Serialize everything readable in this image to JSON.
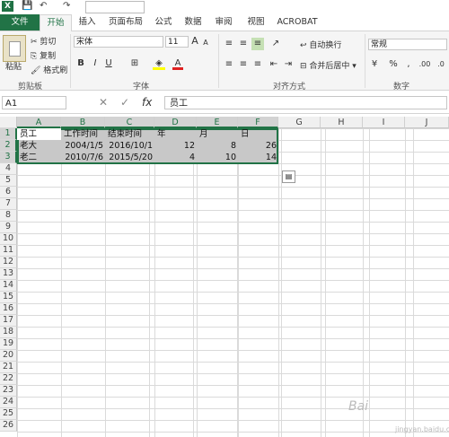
{
  "qat": {
    "logo": "X",
    "save": "💾",
    "undo": "↶",
    "redo": "↷"
  },
  "tabs": [
    "文件",
    "开始",
    "插入",
    "页面布局",
    "公式",
    "数据",
    "审阅",
    "视图",
    "ACROBAT"
  ],
  "clipboard": {
    "paste": "粘贴",
    "cut": "剪切",
    "copy": "复制",
    "format_painter": "格式刷",
    "group": "剪贴板"
  },
  "font": {
    "name": "宋体",
    "size": "11",
    "group": "字体",
    "grow": "A",
    "shrink": "A",
    "bold": "B",
    "italic": "I",
    "underline": "U",
    "fontcolor": "A"
  },
  "align": {
    "wrap": "自动换行",
    "merge": "合并后居中",
    "group": "对齐方式"
  },
  "number": {
    "format": "常规",
    "group": "数字",
    "percent": "%",
    "comma": ","
  },
  "formula_bar": {
    "name_box": "A1",
    "fx": "fx",
    "cancel": "✕",
    "confirm": "✓",
    "value": "员工"
  },
  "columns": [
    "A",
    "B",
    "C",
    "D",
    "E",
    "F",
    "G",
    "H",
    "I",
    "J"
  ],
  "rows": [
    "1",
    "2",
    "3",
    "4",
    "5",
    "6",
    "7",
    "8",
    "9",
    "10",
    "11",
    "12",
    "13",
    "14",
    "15",
    "16",
    "17",
    "18",
    "19",
    "20",
    "21",
    "22",
    "23",
    "24",
    "25",
    "26"
  ],
  "cells": {
    "A1": "员工",
    "B1": "工作时间",
    "C1": "结束时间",
    "D1": "年",
    "E1": "月",
    "F1": "日",
    "A2": "老大",
    "B2": "2004/1/5",
    "C2": "2016/10/1",
    "D2": "12",
    "E2": "8",
    "F2": "26",
    "A3": "老二",
    "B3": "2010/7/6",
    "C3": "2015/5/20",
    "D3": "4",
    "E3": "10",
    "F3": "14"
  },
  "watermark": {
    "brand": "Bai",
    "sub": "jingyan.baidu.com"
  }
}
